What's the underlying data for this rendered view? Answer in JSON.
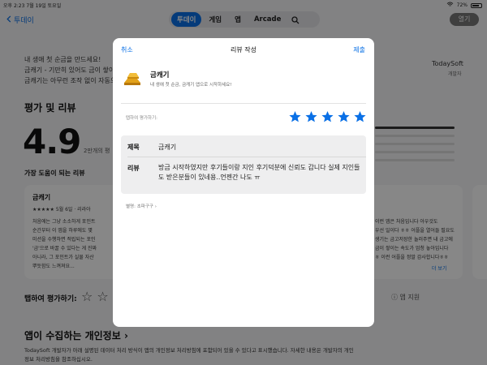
{
  "status_bar": {
    "time": "오후 2:23",
    "date": "7월 19일 토요일",
    "battery": "72%"
  },
  "nav": {
    "back_label": "투데이",
    "tabs": [
      {
        "label": "투데이",
        "active": true
      },
      {
        "label": "게임",
        "active": false
      },
      {
        "label": "앱",
        "active": false
      },
      {
        "label": "Arcade",
        "active": false
      }
    ],
    "open_button": "열기"
  },
  "background": {
    "desc_lines": [
      "내 생애 첫 순금을 만드세요!",
      "금캐기 - 기만히 있어도 금이 쌓이",
      "금캐기는 아무런 조작 없이 자동으"
    ],
    "developer_name": "TodaySoft",
    "developer_label": "개발자",
    "ratings_heading": "평가 및 리뷰",
    "rating_value": "4.9",
    "rating_count": "2만개의 평",
    "helpful_heading": "가장 도움이 되는 리뷰",
    "left_card": {
      "title": "금캐기",
      "meta": "5월 6일 · 리라아",
      "stars": "★★★★★",
      "lines": [
        "처음에는 그냥 소소하게 포인트",
        "순간부터 이 앱을 하루에도 몇 ",
        "미션을 수행하면 적립되는 포인",
        "'금'으로 바꿀 수 있다는 게 진짜",
        "아니라, 그 포인트가 실물 자산",
        "뿌듯함도 느껴져요..."
      ]
    },
    "right_card": {
      "lines": [
        "이런 앱은 처음입니다 아우것도",
        "우선 일이다 ㅎㅎ 어플을 열어들 필요도",
        "생기는 금고저장한 놀러주면 내 금고에",
        "금이 쌓이는 속도가 엄청 놓아입니다",
        "ㅎ 이런 어플을 정말 감사합니다ㅎㅎ"
      ],
      "more_label": "더 보기"
    },
    "tap_rate_label": "탭하여 평가하기:",
    "app_support": "앱 지원",
    "privacy_heading": "앱이 수집하는 개인정보",
    "privacy_text_1": "TodaySoft 개발자가 아래 설명된 데이터 처리 방식이 앱의 개인정보 처리방침에 포함되어 있을 수 있다고 표시했습니다. 자세한 내용은 개발자의 개인",
    "privacy_text_2": "정보 처리방침을 참조하십시오."
  },
  "modal": {
    "cancel": "취소",
    "title": "리뷰 작성",
    "submit": "제출",
    "app_name": "금캐기",
    "app_tagline": "내 생애 첫 순금, 금캐기 앱으로 시작하세요!",
    "tap_to_rate": "탭하여 평가하기:",
    "rating": 5,
    "title_label": "제목",
    "title_value": "금캐기",
    "review_label": "리뷰",
    "review_value": "방금 시작하였지만 후기들이랑 지인 후기덕분에 신뢰도 갑니다 실제 지인들도 받은분들이 있네용..언젠간 나도 ㅠ",
    "author": "별명: 초파구구"
  },
  "colors": {
    "accent": "#0a70e6",
    "star": "#0a70e6",
    "gold": "#e3a21a"
  }
}
